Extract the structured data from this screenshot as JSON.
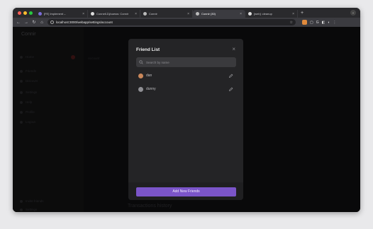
{
  "browser": {
    "tabs": [
      {
        "title": "[FE] Implement –",
        "active": false,
        "favicon_color": "#7b6cd9"
      },
      {
        "title": "Connell-Dj/cuesw: Connir",
        "active": false,
        "favicon_color": "#dddddd"
      },
      {
        "title": "Connir",
        "active": false,
        "favicon_color": "#bbbbbb"
      },
      {
        "title": "Connir (30)",
        "active": true,
        "favicon_color": "#bbbbbb"
      },
      {
        "title": "[web]: cleanup",
        "active": false,
        "favicon_color": "#dddddd"
      }
    ],
    "url": "localhost:3000/webapp/settings/account",
    "traffic_colors": [
      "#ff5f57",
      "#febc2e",
      "#28c840"
    ],
    "ext_icon_color": "#e08a3c",
    "profile_initial": "G"
  },
  "app": {
    "brand": "Connir",
    "sidebar_items": [
      "Home",
      "Friends",
      "Discover",
      "Settings",
      "Help",
      "Profile",
      "Logout"
    ],
    "bottom_items": [
      "Invite friends",
      "Settings"
    ],
    "ghost_heading": "Account",
    "footer_ghost": "Transactions history"
  },
  "modal": {
    "title": "Friend List",
    "close_symbol": "×",
    "search_placeholder": "Search by name",
    "friends": [
      {
        "name": "dan",
        "avatar_color": "#c9875a"
      },
      {
        "name": "dunny",
        "avatar_color": "#8f8f94"
      }
    ],
    "add_button_label": "Add New Friends",
    "accent_color": "#7b55c9"
  }
}
